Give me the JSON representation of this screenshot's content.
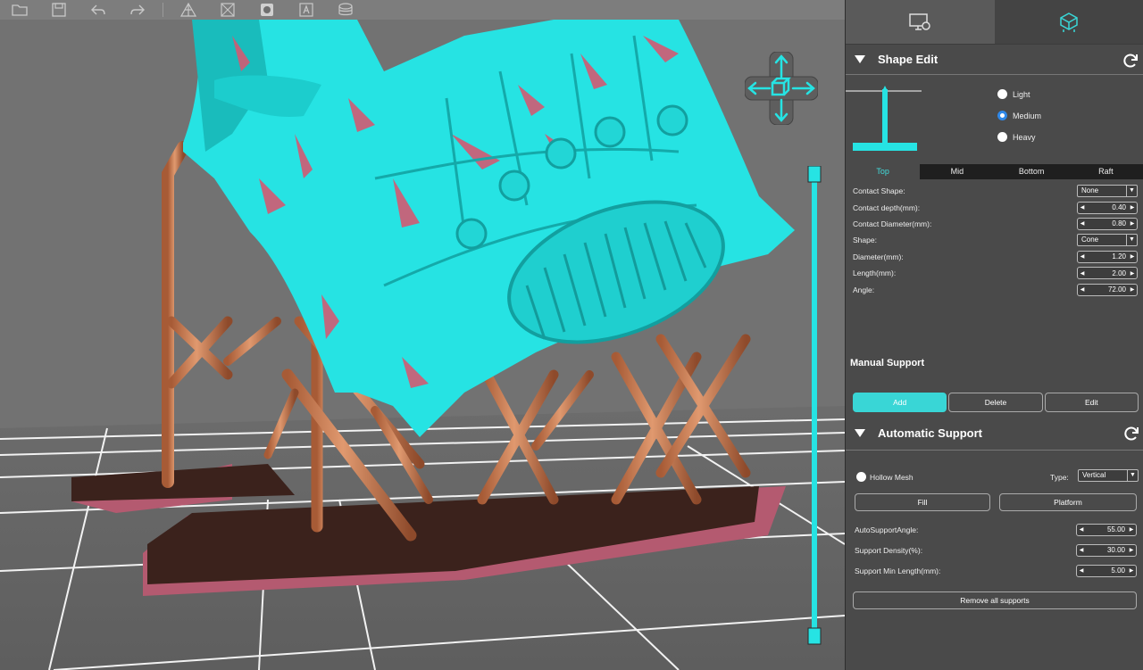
{
  "toolbar": {
    "items": [
      "open-folder-icon",
      "save-icon",
      "undo-icon",
      "redo-icon",
      "support-mode-icon",
      "move-icon",
      "scale-icon",
      "label-icon",
      "layers-icon"
    ]
  },
  "panel": {
    "tabs": [
      "settings-tab",
      "support-tab"
    ],
    "shape_edit": {
      "title": "Shape Edit",
      "presets": [
        "Light",
        "Medium",
        "Heavy"
      ],
      "selected_preset": "Medium",
      "segments": [
        "Top",
        "Mid",
        "Bottom",
        "Raft"
      ],
      "active_segment": "Top",
      "params": {
        "contact_shape_label": "Contact Shape:",
        "contact_shape_value": "None",
        "contact_depth_label": "Contact depth(mm):",
        "contact_depth_value": "0.40",
        "contact_diameter_label": "Contact Diameter(mm):",
        "contact_diameter_value": "0.80",
        "shape_label": "Shape:",
        "shape_value": "Cone",
        "diameter_label": "Diameter(mm):",
        "diameter_value": "1.20",
        "length_label": "Length(mm):",
        "length_value": "2.00",
        "angle_label": "Angle:",
        "angle_value": "72.00"
      }
    },
    "manual_support": {
      "title": "Manual Support",
      "add": "Add",
      "delete": "Delete",
      "edit": "Edit"
    },
    "automatic_support": {
      "title": "Automatic Support",
      "hollow_mesh": "Hollow Mesh",
      "type_label": "Type:",
      "type_value": "Vertical",
      "fill": "Fill",
      "platform": "Platform",
      "auto_angle_label": "AutoSupportAngle:",
      "auto_angle_value": "55.00",
      "density_label": "Support Density(%):",
      "density_value": "30.00",
      "min_length_label": "Support Min Length(mm):",
      "min_length_value": "5.00",
      "remove_all": "Remove all supports"
    }
  },
  "colors": {
    "model": "#26e3e3",
    "model_shade": "#19bcbc",
    "overhang": "#d25a72",
    "support": "#c97a52",
    "support_shade": "#8f4e30",
    "raft": "#3b221c",
    "accent": "#39d6d6"
  }
}
